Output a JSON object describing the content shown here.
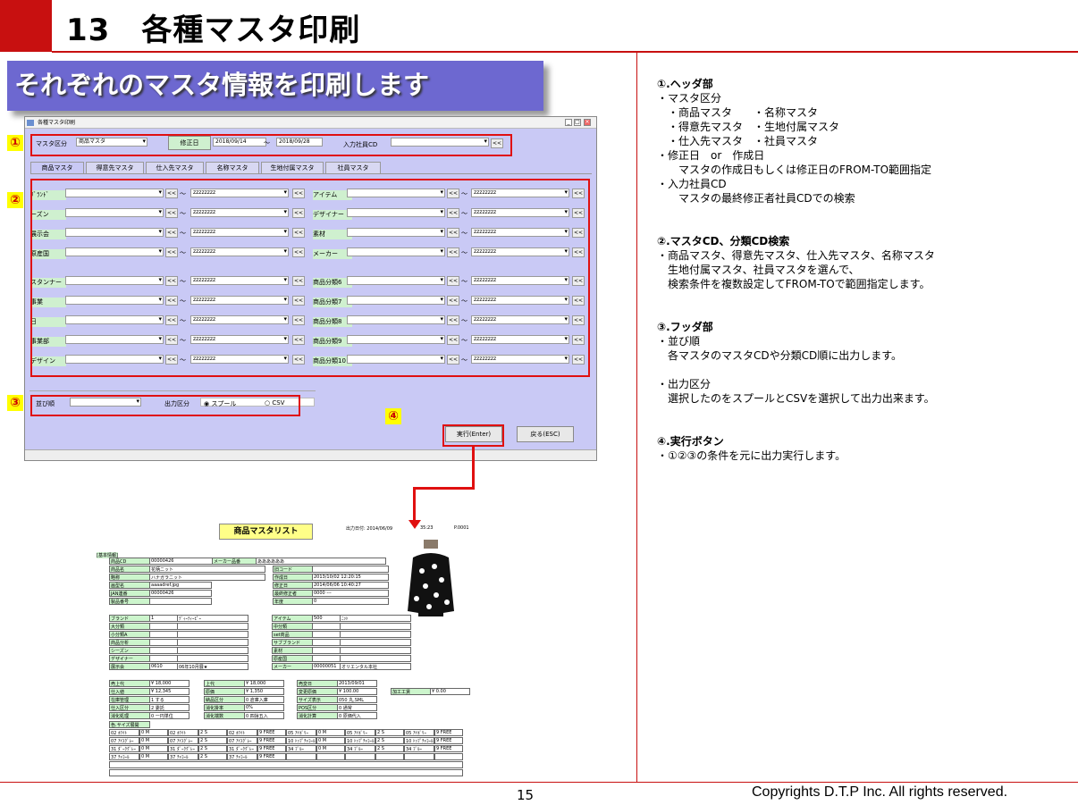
{
  "slide": {
    "title": "13　各種マスタ印刷",
    "banner": "それぞれのマスタ情報を印刷します",
    "page": "15",
    "copyright": "Copyrights  D.T.P Inc. All rights reserved."
  },
  "markers": [
    "①",
    "②",
    "③",
    "④"
  ],
  "window": {
    "title": "各種マスタ印刷",
    "header": {
      "master_label": "マスタ区分",
      "master_value": "商品マスタ",
      "date_button": "修正日",
      "date_from": "2018/09/14",
      "tilde": "～",
      "date_to": "2018/09/28",
      "emp_label": "入力社員CD",
      "search_btn": "<<"
    },
    "tabs": [
      "商品マスタ",
      "得意先マスタ",
      "仕入先マスタ",
      "名称マスタ",
      "生地付属マスタ",
      "社員マスタ"
    ],
    "left_rows": [
      "ﾌﾞﾗﾝﾄﾞ",
      "ーズン",
      "展示会",
      "原産国",
      "スタンナー",
      "事業",
      "日",
      "事業部",
      "デザイン"
    ],
    "right_rows": [
      "アイテム",
      "デザイナー",
      "素材",
      "メーカー",
      "商品分類6",
      "商品分類7",
      "商品分類8",
      "商品分類9",
      "商品分類10"
    ],
    "placeholder": "zzzzzzzz",
    "footer": {
      "sort_label": "並び順",
      "output_label": "出力区分",
      "opt1": "スプール",
      "opt2": "CSV"
    },
    "exec_btn": "実行(Enter)",
    "back_btn": "戻る(ESC)"
  },
  "report": {
    "title": "商品マスタリスト",
    "print_date": "出力日付: 2014/06/09  ",
    "print_time": "35:23",
    "page_no": "P.0001",
    "section": "[基本情報]",
    "basic": [
      [
        "商品CD",
        "00000426"
      ],
      [
        "商品名",
        "花柄ニット"
      ],
      [
        "略称",
        "ハナガラニット"
      ],
      [
        "画型名",
        "aaaadref.jpg"
      ],
      [
        "JAN連番",
        "00000426"
      ],
      [
        "製品番号",
        ""
      ]
    ],
    "maker_label": "メーカー品番",
    "maker_value": "ああああああ",
    "basic2": [
      [
        "旧コード",
        ""
      ],
      [
        "作成日",
        "2013/10/02 12:20:15"
      ],
      [
        "修正日",
        "2014/06/06 10:40:27"
      ],
      [
        "最終修正者",
        "0000 ---"
      ],
      [
        "年度",
        "0"
      ]
    ],
    "attr_left": [
      [
        "ブランド",
        "1",
        "ﾃﾞｨｰﾃｨｰﾋﾟｰ"
      ],
      [
        "大分類",
        "",
        ""
      ],
      [
        "小分類A",
        "",
        ""
      ],
      [
        "商品分析",
        "",
        ""
      ],
      [
        "シーズン",
        "",
        ""
      ],
      [
        "デザイナー",
        "",
        ""
      ],
      [
        "展示会",
        "0610",
        "06年10月展★"
      ]
    ],
    "attr_right": [
      [
        "アイテム",
        "500",
        "ﾆｯﾄ"
      ],
      [
        "中分類",
        "",
        ""
      ],
      [
        "set商品",
        "",
        ""
      ],
      [
        "サブブランド",
        "",
        ""
      ],
      [
        "素材",
        "",
        ""
      ],
      [
        "原産国",
        "",
        ""
      ],
      [
        "メーカー",
        "00000051",
        "オリエンタル本社"
      ]
    ],
    "price1": [
      [
        "売上代",
        "¥ 18,000"
      ],
      [
        "仕入値",
        "¥ 12,345"
      ],
      [
        "在庫管理",
        "1 する"
      ],
      [
        "仕入区分",
        "2 委託"
      ],
      [
        "消化処理",
        "0 一円単位"
      ]
    ],
    "price2": [
      [
        "上代",
        "¥ 18,000"
      ],
      [
        "原価",
        "¥ 1,350"
      ],
      [
        "納品区分",
        "0 倉庫入庫"
      ],
      [
        "消化掛率",
        "0%"
      ],
      [
        "消化端数",
        "0 四捨五入"
      ]
    ],
    "price3": [
      [
        "売変日",
        "2013/09/01"
      ],
      [
        "変更原価",
        "¥ 100.00"
      ],
      [
        "サイズ表示",
        "050  丸,SML"
      ],
      [
        "POS区分",
        "0 通常"
      ],
      [
        "消化計算",
        "0 原価代入"
      ]
    ],
    "proc_label": "加工工賃",
    "proc_value": "¥ 0.00",
    "color_size_label": "色.サイズ展開",
    "color_rows": [
      [
        "02 ﾎﾜｲﾄ",
        "0 M",
        "02 ﾎﾜｲﾄ",
        "2 S",
        "02 ﾎﾜｲﾄ",
        "9 FREE",
        "05 ｱｲﾎﾞﾘｰ",
        "0 M",
        "05 ｱｲﾎﾞﾘｰ",
        "2 S",
        "05 ｱｲﾎﾞﾘｰ",
        "9 FREE"
      ],
      [
        "07 ｱｲｽｸﾞﾚｰ",
        "0 M",
        "07 ｱｲｽｸﾞﾚｰ",
        "2 S",
        "07 ｱｲｽｸﾞﾚｰ",
        "9 FREE",
        "10 ﾄｯﾌﾟﾁｬｺｰﾙ",
        "0 M",
        "10 ﾄｯﾌﾟﾁｬｺｰﾙ",
        "2 S",
        "10 ﾄｯﾌﾟﾁｬｺｰﾙ",
        "9 FREE"
      ],
      [
        "31 ﾀﾞｰｸｸﾞﾚｰ",
        "0 M",
        "31 ﾀﾞｰｸｸﾞﾚｰ",
        "2 S",
        "31 ﾀﾞｰｸｸﾞﾚｰ",
        "9 FREE",
        "34 ﾌﾞﾙｰ",
        "0 M",
        "34 ﾌﾞﾙｰ",
        "2 S",
        "34 ﾌﾞﾙｰ",
        "9 FREE"
      ],
      [
        "37 ﾁｬｺｰﾙ",
        "0 M",
        "37 ﾁｬｺｰﾙ",
        "2 S",
        "37 ﾁｬｺｰﾙ",
        "9 FREE",
        "",
        "",
        "",
        "",
        "",
        ""
      ]
    ]
  },
  "explanation": [
    {
      "text": "①.ヘッダ部",
      "bold": true
    },
    {
      "text": "・マスタ区分",
      "bold": false
    },
    {
      "text": "　・商品マスタ　　・名称マスタ",
      "bold": false
    },
    {
      "text": "　・得意先マスタ　・生地付属マスタ",
      "bold": false
    },
    {
      "text": "　・仕入先マスタ　・社員マスタ",
      "bold": false
    },
    {
      "text": "・修正日　or　作成日",
      "bold": false
    },
    {
      "text": "　　マスタの作成日もしくは修正日のFROM-TO範囲指定",
      "bold": false
    },
    {
      "text": "・入力社員CD",
      "bold": false
    },
    {
      "text": "　　マスタの最終修正者社員CDでの検索",
      "bold": false
    },
    {
      "text": "",
      "bold": false
    },
    {
      "text": "",
      "bold": false
    },
    {
      "text": "②.マスタCD、分類CD検索",
      "bold": true
    },
    {
      "text": "・商品マスタ、得意先マスタ、仕入先マスタ、名称マスタ",
      "bold": false
    },
    {
      "text": "　生地付属マスタ、社員マスタを選んで、",
      "bold": false
    },
    {
      "text": "　検索条件を複数設定してFROM-TOで範囲指定します。",
      "bold": false
    },
    {
      "text": "",
      "bold": false
    },
    {
      "text": "",
      "bold": false
    },
    {
      "text": "③.フッダ部",
      "bold": true
    },
    {
      "text": "・並び順",
      "bold": false
    },
    {
      "text": "　各マスタのマスタCDや分類CD順に出力します。",
      "bold": false
    },
    {
      "text": "",
      "bold": false
    },
    {
      "text": "・出力区分",
      "bold": false
    },
    {
      "text": "　選択したのをスプールとCSVを選択して出力出来ます。",
      "bold": false
    },
    {
      "text": "",
      "bold": false
    },
    {
      "text": "",
      "bold": false
    },
    {
      "text": "④.実行ボタン",
      "bold": true
    },
    {
      "text": "・①②③の条件を元に出力実行します。",
      "bold": false
    }
  ]
}
